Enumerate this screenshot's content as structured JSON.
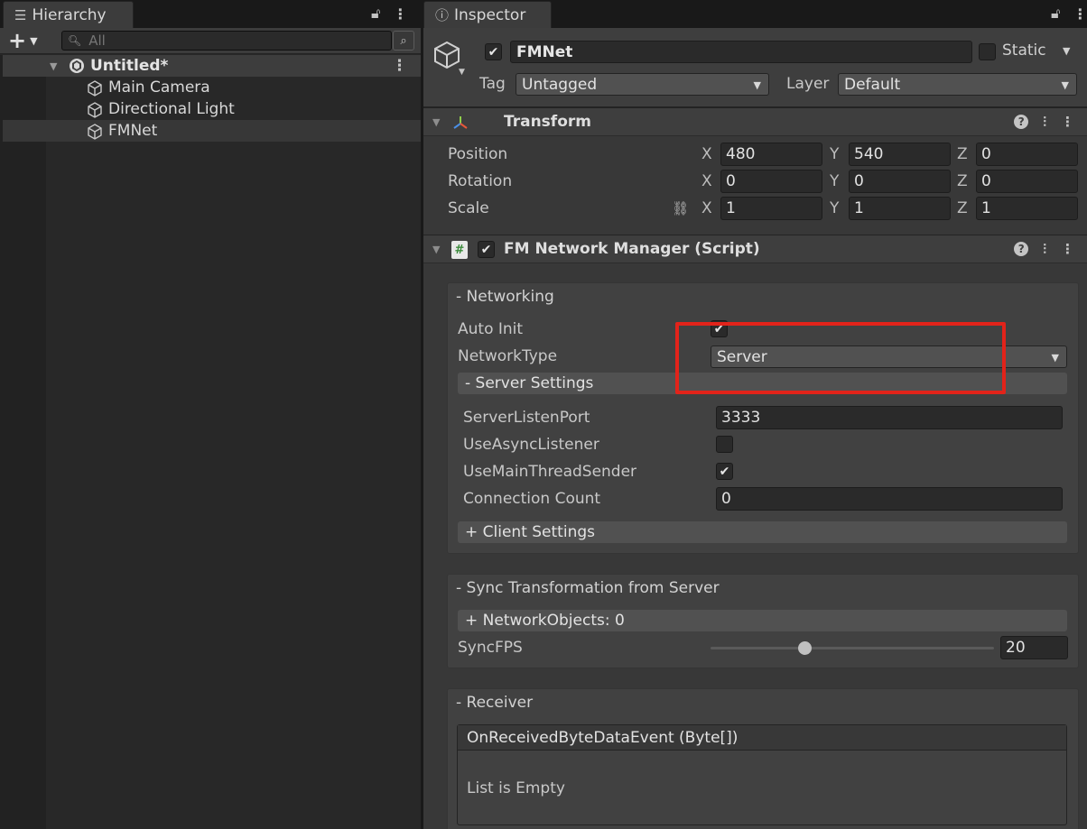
{
  "hierarchy": {
    "tab_title": "Hierarchy",
    "search_placeholder": "All",
    "scene_name": "Untitled*",
    "objects": [
      "Main Camera",
      "Directional Light",
      "FMNet"
    ]
  },
  "inspector": {
    "tab_title": "Inspector",
    "object_name": "FMNet",
    "static_label": "Static",
    "tag_label": "Tag",
    "tag_value": "Untagged",
    "layer_label": "Layer",
    "layer_value": "Default",
    "transform": {
      "title": "Transform",
      "rows": [
        {
          "label": "Position",
          "x": "480",
          "y": "540",
          "z": "0"
        },
        {
          "label": "Rotation",
          "x": "0",
          "y": "0",
          "z": "0"
        },
        {
          "label": "Scale",
          "x": "1",
          "y": "1",
          "z": "1"
        }
      ],
      "axis_labels": [
        "X",
        "Y",
        "Z"
      ]
    },
    "script": {
      "title": "FM Network Manager (Script)",
      "networking": {
        "header": "- Networking",
        "auto_init_label": "Auto Init",
        "auto_init": true,
        "network_type_label": "NetworkType",
        "network_type": "Server",
        "server_settings": {
          "header": "- Server Settings",
          "listen_port_label": "ServerListenPort",
          "listen_port": "3333",
          "async_listener_label": "UseAsyncListener",
          "async_listener": false,
          "main_thread_sender_label": "UseMainThreadSender",
          "main_thread_sender": true,
          "connection_count_label": "Connection Count",
          "connection_count": "0"
        },
        "client_settings_header": "+ Client Settings"
      },
      "sync": {
        "header": "- Sync Transformation from Server",
        "network_objects": "+ NetworkObjects: 0",
        "sync_fps_label": "SyncFPS",
        "sync_fps": "20",
        "sync_fps_slider_fraction": 0.33
      },
      "receiver": {
        "header": "- Receiver",
        "event_title": "OnReceivedByteDataEvent (Byte[])",
        "empty_text": "List is Empty"
      }
    }
  },
  "colors": {
    "highlight": "#e2231a",
    "panel_bg": "#383838",
    "field_bg": "#2a2a2a"
  }
}
